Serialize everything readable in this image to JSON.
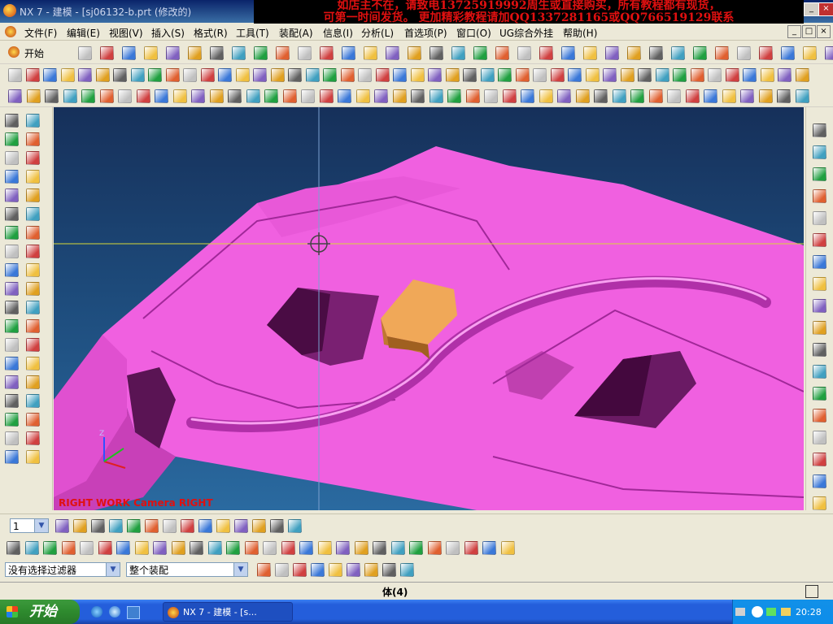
{
  "window": {
    "title": "NX 7 - 建模 - [sj06132-b.prt (修改的)",
    "controls": [
      "_",
      "□",
      "×"
    ]
  },
  "banner": {
    "line1": "如店主不在，请致电13725919992周生或直接购买，所有教程都有现货，",
    "line2": "可第一时间发货。 更加精彩教程请加QQ1337281165或QQ766519129联系"
  },
  "menubar": {
    "items": [
      "文件(F)",
      "编辑(E)",
      "视图(V)",
      "插入(S)",
      "格式(R)",
      "工具(T)",
      "装配(A)",
      "信息(I)",
      "分析(L)",
      "首选项(P)",
      "窗口(O)",
      "UG综合外挂",
      "帮助(H)"
    ]
  },
  "toolbar": {
    "start_label": "开始"
  },
  "viewport": {
    "view_label": "RIGHT WORK Camera RIGHT",
    "triad_z": "Z",
    "colors": {
      "part": "#f060e0",
      "part_shadow": "#b030a8",
      "part_dark": "#6a1a64",
      "block": "#f0a858",
      "background_top": "#16305a",
      "background_bottom": "#2a6aa0",
      "crosshair": "#d8d838"
    }
  },
  "bottom": {
    "layer_value": "1",
    "filter_value": "没有选择过滤器",
    "scope_value": "整个装配"
  },
  "status": {
    "text": "体(4)"
  },
  "taskbar": {
    "start_label": "开始",
    "task_label": "NX 7 - 建模 - [s...",
    "clock": "20:28"
  }
}
